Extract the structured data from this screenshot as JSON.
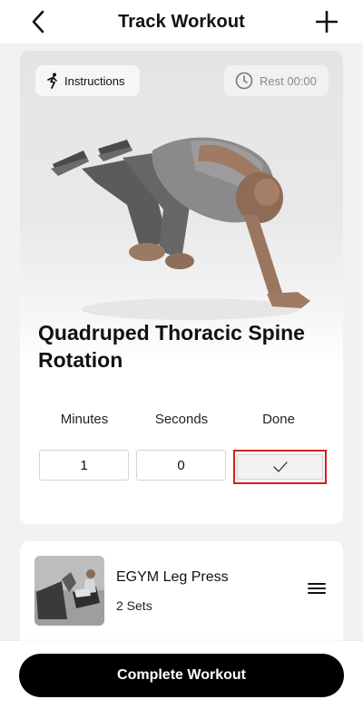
{
  "header": {
    "title": "Track Workout",
    "back_icon": "chevron-left-icon",
    "add_icon": "plus-icon"
  },
  "exercise": {
    "instructions_label": "Instructions",
    "instructions_icon": "running-figure-icon",
    "rest_label": "Rest 00:00",
    "rest_icon": "clock-icon",
    "name": "Quadruped Thoracic Spine Rotation",
    "columns": {
      "minutes": "Minutes",
      "seconds": "Seconds",
      "done": "Done"
    },
    "values": {
      "minutes": "1",
      "seconds": "0",
      "done_icon": "checkmark-icon"
    },
    "highlight_color": "#d32222"
  },
  "next_exercise": {
    "name": "EGYM Leg Press",
    "sets": "2 Sets",
    "drag_icon": "menu-drag-icon"
  },
  "footer": {
    "complete_label": "Complete Workout"
  }
}
